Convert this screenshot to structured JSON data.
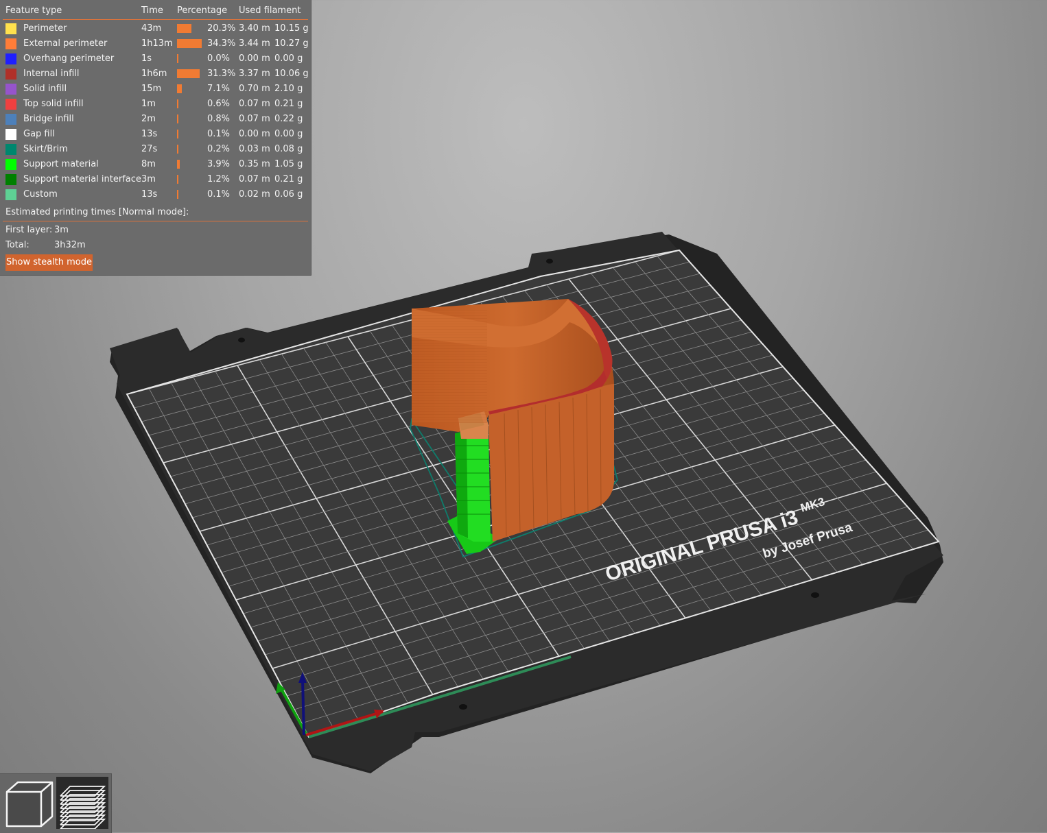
{
  "legend": {
    "headers": {
      "feature_type": "Feature type",
      "time": "Time",
      "percentage": "Percentage",
      "used_filament": "Used filament"
    },
    "rows": [
      {
        "label": "Perimeter",
        "color": "#ffe14d",
        "time": "43m",
        "percent": "20.3%",
        "percent_value": 20.3,
        "length": "3.40 m",
        "weight": "10.15 g"
      },
      {
        "label": "External perimeter",
        "color": "#ff7d38",
        "time": "1h13m",
        "percent": "34.3%",
        "percent_value": 34.3,
        "length": "3.44 m",
        "weight": "10.27 g"
      },
      {
        "label": "Overhang perimeter",
        "color": "#1f1fff",
        "time": "1s",
        "percent": "0.0%",
        "percent_value": 0.0,
        "length": "0.00 m",
        "weight": "0.00 g"
      },
      {
        "label": "Internal infill",
        "color": "#b03029",
        "time": "1h6m",
        "percent": "31.3%",
        "percent_value": 31.3,
        "length": "3.37 m",
        "weight": "10.06 g"
      },
      {
        "label": "Solid infill",
        "color": "#9654cc",
        "time": "15m",
        "percent": "7.1%",
        "percent_value": 7.1,
        "length": "0.70 m",
        "weight": "2.10 g"
      },
      {
        "label": "Top solid infill",
        "color": "#f04040",
        "time": "1m",
        "percent": "0.6%",
        "percent_value": 0.6,
        "length": "0.07 m",
        "weight": "0.21 g"
      },
      {
        "label": "Bridge infill",
        "color": "#4d80ba",
        "time": "2m",
        "percent": "0.8%",
        "percent_value": 0.8,
        "length": "0.07 m",
        "weight": "0.22 g"
      },
      {
        "label": "Gap fill",
        "color": "#ffffff",
        "time": "13s",
        "percent": "0.1%",
        "percent_value": 0.1,
        "length": "0.00 m",
        "weight": "0.00 g"
      },
      {
        "label": "Skirt/Brim",
        "color": "#00876e",
        "time": "27s",
        "percent": "0.2%",
        "percent_value": 0.2,
        "length": "0.03 m",
        "weight": "0.08 g"
      },
      {
        "label": "Support material",
        "color": "#00ff00",
        "time": "8m",
        "percent": "3.9%",
        "percent_value": 3.9,
        "length": "0.35 m",
        "weight": "1.05 g"
      },
      {
        "label": "Support material interface",
        "color": "#008000",
        "time": "3m",
        "percent": "1.2%",
        "percent_value": 1.2,
        "length": "0.07 m",
        "weight": "0.21 g"
      },
      {
        "label": "Custom",
        "color": "#5ed194",
        "time": "13s",
        "percent": "0.1%",
        "percent_value": 0.1,
        "length": "0.02 m",
        "weight": "0.06 g"
      }
    ],
    "estimate_title": "Estimated printing times [Normal mode]:",
    "first_layer_label": "First layer:",
    "first_layer_value": "3m",
    "total_label": "Total:",
    "total_value": "3h32m",
    "stealth_button": "Show stealth mode"
  },
  "bed": {
    "brand_line1": "ORIGINAL PRUSA i3",
    "brand_model": "MK3",
    "brand_line2": "by Josef Prusa"
  },
  "colors": {
    "accent": "#e0733a",
    "panel": "#6b6b6b",
    "model_orange": "#c8652a",
    "support_green": "#19d619"
  },
  "toolbar": {
    "items": [
      {
        "icon": "cube-3d-view-icon"
      },
      {
        "icon": "layers-preview-icon"
      }
    ]
  }
}
